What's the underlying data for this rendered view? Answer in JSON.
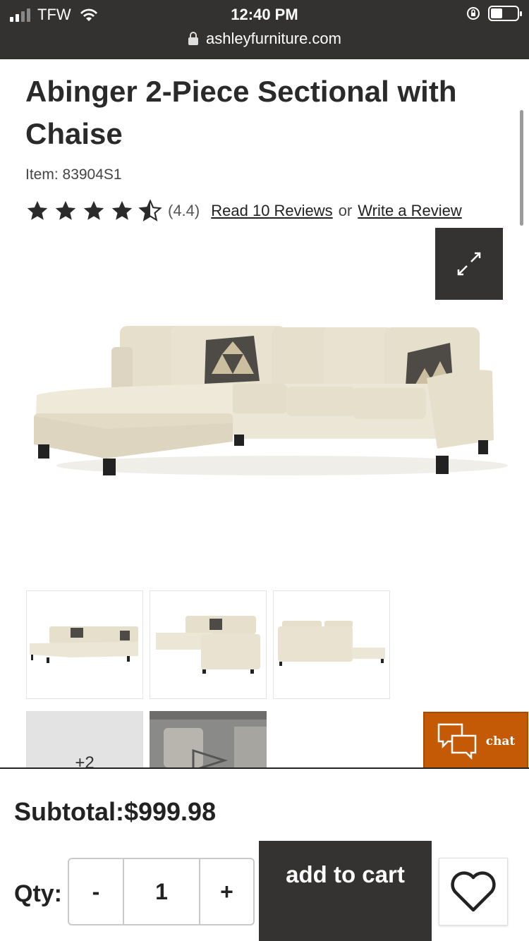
{
  "status_bar": {
    "carrier": "TFW",
    "time": "12:40 PM",
    "url": "ashleyfurniture.com"
  },
  "product": {
    "title": "Abinger 2-Piece Sectional with Chaise",
    "item_number": "Item: 83904S1",
    "rating_text": "(4.4)",
    "rating_value": 4.4,
    "rating_max": 5,
    "read_reviews": "Read 10 Reviews",
    "or": "or",
    "write_review": "Write a Review"
  },
  "gallery": {
    "more_label": "+2"
  },
  "chat": {
    "label": "chat"
  },
  "purchase": {
    "subtotal": "Subtotal:$999.98",
    "qty_label": "Qty:",
    "minus": "-",
    "quantity": "1",
    "plus": "+",
    "add_to_cart": "add to cart"
  },
  "colors": {
    "dark": "#343331",
    "chat_orange": "#c45a05",
    "sofa": "#ece6d6"
  }
}
